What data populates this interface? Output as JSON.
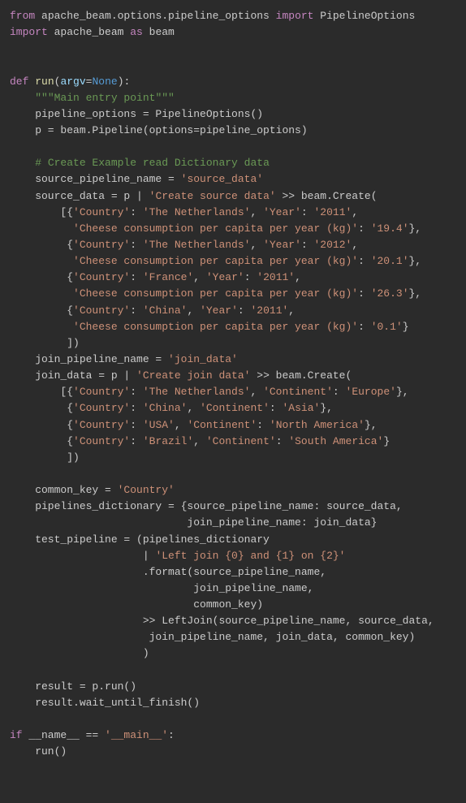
{
  "code_lines": [
    {
      "segments": [
        {
          "t": "from ",
          "c": "kw"
        },
        {
          "t": "apache_beam.options.pipeline_options ",
          "c": "id"
        },
        {
          "t": "import ",
          "c": "kw"
        },
        {
          "t": "PipelineOptions",
          "c": "id"
        }
      ]
    },
    {
      "segments": [
        {
          "t": "import ",
          "c": "kw"
        },
        {
          "t": "apache_beam ",
          "c": "id"
        },
        {
          "t": "as ",
          "c": "kw"
        },
        {
          "t": "beam",
          "c": "id"
        }
      ]
    },
    {
      "segments": [
        {
          "t": "",
          "c": "id"
        }
      ]
    },
    {
      "segments": [
        {
          "t": "",
          "c": "id"
        }
      ]
    },
    {
      "segments": [
        {
          "t": "def ",
          "c": "kw"
        },
        {
          "t": "run",
          "c": "fn"
        },
        {
          "t": "(",
          "c": "punc"
        },
        {
          "t": "argv",
          "c": "param"
        },
        {
          "t": "=",
          "c": "punc"
        },
        {
          "t": "None",
          "c": "none"
        },
        {
          "t": "):",
          "c": "punc"
        }
      ]
    },
    {
      "segments": [
        {
          "t": "    ",
          "c": "id"
        },
        {
          "t": "\"\"\"Main entry point\"\"\"",
          "c": "doc"
        }
      ]
    },
    {
      "segments": [
        {
          "t": "    pipeline_options = PipelineOptions()",
          "c": "id"
        }
      ]
    },
    {
      "segments": [
        {
          "t": "    p = beam.Pipeline(options=pipeline_options)",
          "c": "id"
        }
      ]
    },
    {
      "segments": [
        {
          "t": "",
          "c": "id"
        }
      ]
    },
    {
      "segments": [
        {
          "t": "    ",
          "c": "id"
        },
        {
          "t": "# Create Example read Dictionary data",
          "c": "cmt"
        }
      ]
    },
    {
      "segments": [
        {
          "t": "    source_pipeline_name = ",
          "c": "id"
        },
        {
          "t": "'source_data'",
          "c": "str"
        }
      ]
    },
    {
      "segments": [
        {
          "t": "    source_data = p | ",
          "c": "id"
        },
        {
          "t": "'Create source data'",
          "c": "str"
        },
        {
          "t": " >> beam.Create(",
          "c": "id"
        }
      ]
    },
    {
      "segments": [
        {
          "t": "        [{",
          "c": "id"
        },
        {
          "t": "'Country'",
          "c": "str"
        },
        {
          "t": ": ",
          "c": "id"
        },
        {
          "t": "'The Netherlands'",
          "c": "str"
        },
        {
          "t": ", ",
          "c": "id"
        },
        {
          "t": "'Year'",
          "c": "str"
        },
        {
          "t": ": ",
          "c": "id"
        },
        {
          "t": "'2011'",
          "c": "str"
        },
        {
          "t": ",",
          "c": "id"
        }
      ]
    },
    {
      "segments": [
        {
          "t": "          ",
          "c": "id"
        },
        {
          "t": "'Cheese consumption per capita per year (kg)'",
          "c": "str"
        },
        {
          "t": ": ",
          "c": "id"
        },
        {
          "t": "'19.4'",
          "c": "str"
        },
        {
          "t": "},",
          "c": "id"
        }
      ]
    },
    {
      "segments": [
        {
          "t": "         {",
          "c": "id"
        },
        {
          "t": "'Country'",
          "c": "str"
        },
        {
          "t": ": ",
          "c": "id"
        },
        {
          "t": "'The Netherlands'",
          "c": "str"
        },
        {
          "t": ", ",
          "c": "id"
        },
        {
          "t": "'Year'",
          "c": "str"
        },
        {
          "t": ": ",
          "c": "id"
        },
        {
          "t": "'2012'",
          "c": "str"
        },
        {
          "t": ",",
          "c": "id"
        }
      ]
    },
    {
      "segments": [
        {
          "t": "          ",
          "c": "id"
        },
        {
          "t": "'Cheese consumption per capita per year (kg)'",
          "c": "str"
        },
        {
          "t": ": ",
          "c": "id"
        },
        {
          "t": "'20.1'",
          "c": "str"
        },
        {
          "t": "},",
          "c": "id"
        }
      ]
    },
    {
      "segments": [
        {
          "t": "         {",
          "c": "id"
        },
        {
          "t": "'Country'",
          "c": "str"
        },
        {
          "t": ": ",
          "c": "id"
        },
        {
          "t": "'France'",
          "c": "str"
        },
        {
          "t": ", ",
          "c": "id"
        },
        {
          "t": "'Year'",
          "c": "str"
        },
        {
          "t": ": ",
          "c": "id"
        },
        {
          "t": "'2011'",
          "c": "str"
        },
        {
          "t": ",",
          "c": "id"
        }
      ]
    },
    {
      "segments": [
        {
          "t": "          ",
          "c": "id"
        },
        {
          "t": "'Cheese consumption per capita per year (kg)'",
          "c": "str"
        },
        {
          "t": ": ",
          "c": "id"
        },
        {
          "t": "'26.3'",
          "c": "str"
        },
        {
          "t": "},",
          "c": "id"
        }
      ]
    },
    {
      "segments": [
        {
          "t": "         {",
          "c": "id"
        },
        {
          "t": "'Country'",
          "c": "str"
        },
        {
          "t": ": ",
          "c": "id"
        },
        {
          "t": "'China'",
          "c": "str"
        },
        {
          "t": ", ",
          "c": "id"
        },
        {
          "t": "'Year'",
          "c": "str"
        },
        {
          "t": ": ",
          "c": "id"
        },
        {
          "t": "'2011'",
          "c": "str"
        },
        {
          "t": ",",
          "c": "id"
        }
      ]
    },
    {
      "segments": [
        {
          "t": "          ",
          "c": "id"
        },
        {
          "t": "'Cheese consumption per capita per year (kg)'",
          "c": "str"
        },
        {
          "t": ": ",
          "c": "id"
        },
        {
          "t": "'0.1'",
          "c": "str"
        },
        {
          "t": "}",
          "c": "id"
        }
      ]
    },
    {
      "segments": [
        {
          "t": "         ])",
          "c": "id"
        }
      ]
    },
    {
      "segments": [
        {
          "t": "    join_pipeline_name = ",
          "c": "id"
        },
        {
          "t": "'join_data'",
          "c": "str"
        }
      ]
    },
    {
      "segments": [
        {
          "t": "    join_data = p | ",
          "c": "id"
        },
        {
          "t": "'Create join data'",
          "c": "str"
        },
        {
          "t": " >> beam.Create(",
          "c": "id"
        }
      ]
    },
    {
      "segments": [
        {
          "t": "        [{",
          "c": "id"
        },
        {
          "t": "'Country'",
          "c": "str"
        },
        {
          "t": ": ",
          "c": "id"
        },
        {
          "t": "'The Netherlands'",
          "c": "str"
        },
        {
          "t": ", ",
          "c": "id"
        },
        {
          "t": "'Continent'",
          "c": "str"
        },
        {
          "t": ": ",
          "c": "id"
        },
        {
          "t": "'Europe'",
          "c": "str"
        },
        {
          "t": "},",
          "c": "id"
        }
      ]
    },
    {
      "segments": [
        {
          "t": "         {",
          "c": "id"
        },
        {
          "t": "'Country'",
          "c": "str"
        },
        {
          "t": ": ",
          "c": "id"
        },
        {
          "t": "'China'",
          "c": "str"
        },
        {
          "t": ", ",
          "c": "id"
        },
        {
          "t": "'Continent'",
          "c": "str"
        },
        {
          "t": ": ",
          "c": "id"
        },
        {
          "t": "'Asia'",
          "c": "str"
        },
        {
          "t": "},",
          "c": "id"
        }
      ]
    },
    {
      "segments": [
        {
          "t": "         {",
          "c": "id"
        },
        {
          "t": "'Country'",
          "c": "str"
        },
        {
          "t": ": ",
          "c": "id"
        },
        {
          "t": "'USA'",
          "c": "str"
        },
        {
          "t": ", ",
          "c": "id"
        },
        {
          "t": "'Continent'",
          "c": "str"
        },
        {
          "t": ": ",
          "c": "id"
        },
        {
          "t": "'North America'",
          "c": "str"
        },
        {
          "t": "},",
          "c": "id"
        }
      ]
    },
    {
      "segments": [
        {
          "t": "         {",
          "c": "id"
        },
        {
          "t": "'Country'",
          "c": "str"
        },
        {
          "t": ": ",
          "c": "id"
        },
        {
          "t": "'Brazil'",
          "c": "str"
        },
        {
          "t": ", ",
          "c": "id"
        },
        {
          "t": "'Continent'",
          "c": "str"
        },
        {
          "t": ": ",
          "c": "id"
        },
        {
          "t": "'South America'",
          "c": "str"
        },
        {
          "t": "}",
          "c": "id"
        }
      ]
    },
    {
      "segments": [
        {
          "t": "         ])",
          "c": "id"
        }
      ]
    },
    {
      "segments": [
        {
          "t": "",
          "c": "id"
        }
      ]
    },
    {
      "segments": [
        {
          "t": "    common_key = ",
          "c": "id"
        },
        {
          "t": "'Country'",
          "c": "str"
        }
      ]
    },
    {
      "segments": [
        {
          "t": "    pipelines_dictionary = {source_pipeline_name: source_data,",
          "c": "id"
        }
      ]
    },
    {
      "segments": [
        {
          "t": "                            join_pipeline_name: join_data}",
          "c": "id"
        }
      ]
    },
    {
      "segments": [
        {
          "t": "    test_pipeline = (pipelines_dictionary",
          "c": "id"
        }
      ]
    },
    {
      "segments": [
        {
          "t": "                     | ",
          "c": "id"
        },
        {
          "t": "'Left join {0} and {1} on {2}'",
          "c": "str"
        }
      ]
    },
    {
      "segments": [
        {
          "t": "                     .format(source_pipeline_name,",
          "c": "id"
        }
      ]
    },
    {
      "segments": [
        {
          "t": "                             join_pipeline_name,",
          "c": "id"
        }
      ]
    },
    {
      "segments": [
        {
          "t": "                             common_key)",
          "c": "id"
        }
      ]
    },
    {
      "segments": [
        {
          "t": "                     >> LeftJoin(source_pipeline_name, source_data,",
          "c": "id"
        }
      ]
    },
    {
      "segments": [
        {
          "t": "                      join_pipeline_name, join_data, common_key)",
          "c": "id"
        }
      ]
    },
    {
      "segments": [
        {
          "t": "                     )",
          "c": "id"
        }
      ]
    },
    {
      "segments": [
        {
          "t": "",
          "c": "id"
        }
      ]
    },
    {
      "segments": [
        {
          "t": "    result = p.run()",
          "c": "id"
        }
      ]
    },
    {
      "segments": [
        {
          "t": "    result.wait_until_finish()",
          "c": "id"
        }
      ]
    },
    {
      "segments": [
        {
          "t": "",
          "c": "id"
        }
      ]
    },
    {
      "segments": [
        {
          "t": "if ",
          "c": "kw"
        },
        {
          "t": "__name__ == ",
          "c": "id"
        },
        {
          "t": "'__main__'",
          "c": "str"
        },
        {
          "t": ":",
          "c": "id"
        }
      ]
    },
    {
      "segments": [
        {
          "t": "    run()",
          "c": "id"
        }
      ]
    }
  ]
}
